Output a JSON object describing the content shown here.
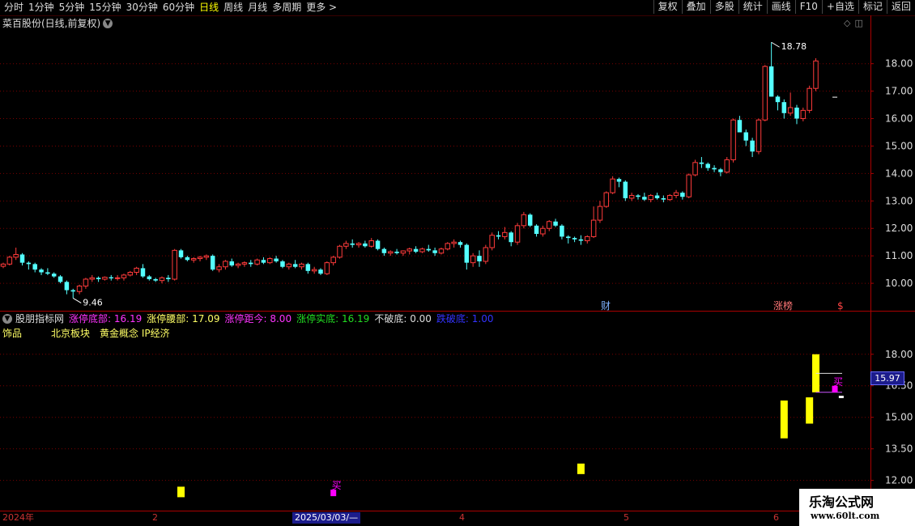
{
  "toolbar": {
    "periods": [
      "分时",
      "1分钟",
      "5分钟",
      "15分钟",
      "30分钟",
      "60分钟",
      "日线",
      "周线",
      "月线",
      "多周期",
      "更多 >"
    ],
    "active_period": "日线",
    "tools": [
      "复权",
      "叠加",
      "多股",
      "统计",
      "画线",
      "F10",
      "+自选",
      "标记",
      "返回"
    ]
  },
  "stock": {
    "title": "菜百股份(日线,前复权)"
  },
  "main_chart": {
    "max_label": "18.78",
    "min_label": "9.46",
    "markers": [
      {
        "text": "财",
        "color": "#7fb2ff"
      },
      {
        "text": "涨榜",
        "color": "#ff7777"
      },
      {
        "text": "$",
        "color": "#ff4444"
      }
    ]
  },
  "indicator": {
    "name": "股朋指标网",
    "fields": [
      {
        "label": "涨停底部:",
        "value": "16.19",
        "color": "#ff33ff"
      },
      {
        "label": "涨停腰部:",
        "value": "17.09",
        "color": "#ffff66"
      },
      {
        "label": "涨停距今:",
        "value": "8.00",
        "color": "#ff33ff"
      },
      {
        "label": "涨停实底:",
        "value": "16.19",
        "color": "#22dd22"
      },
      {
        "label": "不破底:",
        "value": "0.00",
        "color": "#dddddd"
      },
      {
        "label": "跌破底:",
        "value": "1.00",
        "color": "#3333ff"
      }
    ],
    "sector": "饰品　　　北京板块　黄金概念 IP经济",
    "buy_label": "买",
    "current_price": "15.97",
    "signal_colors": {
      "bar": "#ffff00",
      "buy": "#ff00ff",
      "line1": "#dddddd",
      "line2": "#cc55ff"
    }
  },
  "time_axis": {
    "labels": [
      "2024年",
      "2",
      "2025/03/03/—",
      "4",
      "5",
      "6"
    ],
    "selected": "2025/03/03/—"
  },
  "watermark": {
    "title": "乐淘公式网",
    "url": "www.60lt.com"
  },
  "chart_data": [
    {
      "type": "candlestick",
      "title": "菜百股份(日线,前复权)",
      "y_ticks": [
        10.0,
        11.0,
        12.0,
        13.0,
        14.0,
        15.0,
        16.0,
        17.0,
        18.0
      ],
      "ylim": [
        9.0,
        19.2
      ],
      "grid": true,
      "colors": {
        "up": "#ff3b3b",
        "down": "#54ffff",
        "grid": "#7a0000"
      },
      "ohlc": [
        [
          10.62,
          10.75,
          10.55,
          10.7
        ],
        [
          10.7,
          11.0,
          10.65,
          10.95
        ],
        [
          10.95,
          11.3,
          10.85,
          11.05
        ],
        [
          11.05,
          11.1,
          10.65,
          10.75
        ],
        [
          10.75,
          10.8,
          10.5,
          10.7
        ],
        [
          10.7,
          10.75,
          10.4,
          10.5
        ],
        [
          10.5,
          10.55,
          10.3,
          10.4
        ],
        [
          10.4,
          10.55,
          10.3,
          10.35
        ],
        [
          10.35,
          10.4,
          10.2,
          10.25
        ],
        [
          10.25,
          10.3,
          10.0,
          10.05
        ],
        [
          10.05,
          10.1,
          9.6,
          9.75
        ],
        [
          9.75,
          9.8,
          9.46,
          9.7
        ],
        [
          9.7,
          9.95,
          9.6,
          9.9
        ],
        [
          9.9,
          10.2,
          9.8,
          10.15
        ],
        [
          10.15,
          10.3,
          10.05,
          10.2
        ],
        [
          10.2,
          10.25,
          10.05,
          10.15
        ],
        [
          10.15,
          10.25,
          10.1,
          10.22
        ],
        [
          10.22,
          10.3,
          10.1,
          10.18
        ],
        [
          10.18,
          10.3,
          10.1,
          10.2
        ],
        [
          10.2,
          10.35,
          10.1,
          10.3
        ],
        [
          10.3,
          10.45,
          10.25,
          10.4
        ],
        [
          10.4,
          10.6,
          10.3,
          10.55
        ],
        [
          10.55,
          10.7,
          10.2,
          10.25
        ],
        [
          10.25,
          10.3,
          10.1,
          10.15
        ],
        [
          10.15,
          10.2,
          10.05,
          10.1
        ],
        [
          10.1,
          10.25,
          10.0,
          10.2
        ],
        [
          10.2,
          10.3,
          10.05,
          10.15
        ],
        [
          10.15,
          11.25,
          10.1,
          11.2
        ],
        [
          11.2,
          11.25,
          10.9,
          10.95
        ],
        [
          10.95,
          11.0,
          10.8,
          10.85
        ],
        [
          10.85,
          10.95,
          10.75,
          10.9
        ],
        [
          10.9,
          11.0,
          10.8,
          10.95
        ],
        [
          10.95,
          11.05,
          10.85,
          11.0
        ],
        [
          11.0,
          11.05,
          10.45,
          10.5
        ],
        [
          10.5,
          10.7,
          10.4,
          10.6
        ],
        [
          10.6,
          10.85,
          10.5,
          10.8
        ],
        [
          10.8,
          10.9,
          10.6,
          10.65
        ],
        [
          10.65,
          10.75,
          10.55,
          10.7
        ],
        [
          10.7,
          10.8,
          10.6,
          10.75
        ],
        [
          10.75,
          10.85,
          10.6,
          10.7
        ],
        [
          10.7,
          10.9,
          10.65,
          10.85
        ],
        [
          10.85,
          10.95,
          10.7,
          10.75
        ],
        [
          10.75,
          10.95,
          10.7,
          10.9
        ],
        [
          10.9,
          11.0,
          10.75,
          10.8
        ],
        [
          10.8,
          10.85,
          10.55,
          10.6
        ],
        [
          10.6,
          10.75,
          10.5,
          10.7
        ],
        [
          10.7,
          10.85,
          10.55,
          10.6
        ],
        [
          10.6,
          10.75,
          10.5,
          10.7
        ],
        [
          10.7,
          10.75,
          10.35,
          10.45
        ],
        [
          10.45,
          10.6,
          10.35,
          10.5
        ],
        [
          10.5,
          10.55,
          10.3,
          10.35
        ],
        [
          10.35,
          10.8,
          10.3,
          10.75
        ],
        [
          10.75,
          11.0,
          10.65,
          10.95
        ],
        [
          10.95,
          11.4,
          10.9,
          11.35
        ],
        [
          11.35,
          11.55,
          11.25,
          11.45
        ],
        [
          11.45,
          11.6,
          11.3,
          11.4
        ],
        [
          11.4,
          11.5,
          11.3,
          11.45
        ],
        [
          11.45,
          11.55,
          11.3,
          11.35
        ],
        [
          11.35,
          11.65,
          11.3,
          11.55
        ],
        [
          11.55,
          11.6,
          11.2,
          11.25
        ],
        [
          11.25,
          11.3,
          11.0,
          11.1
        ],
        [
          11.1,
          11.2,
          11.0,
          11.15
        ],
        [
          11.15,
          11.25,
          11.05,
          11.1
        ],
        [
          11.1,
          11.2,
          11.0,
          11.18
        ],
        [
          11.18,
          11.3,
          11.05,
          11.25
        ],
        [
          11.25,
          11.35,
          11.1,
          11.15
        ],
        [
          11.15,
          11.3,
          11.1,
          11.25
        ],
        [
          11.25,
          11.4,
          11.15,
          11.2
        ],
        [
          11.2,
          11.3,
          11.0,
          11.1
        ],
        [
          11.1,
          11.3,
          11.05,
          11.25
        ],
        [
          11.25,
          11.5,
          11.2,
          11.45
        ],
        [
          11.45,
          11.6,
          11.3,
          11.5
        ],
        [
          11.5,
          11.55,
          11.3,
          11.4
        ],
        [
          11.4,
          11.45,
          10.5,
          10.75
        ],
        [
          10.75,
          11.1,
          10.6,
          11.0
        ],
        [
          11.0,
          11.2,
          10.6,
          10.8
        ],
        [
          10.8,
          11.4,
          10.7,
          11.3
        ],
        [
          11.3,
          11.85,
          11.2,
          11.75
        ],
        [
          11.75,
          11.9,
          11.6,
          11.7
        ],
        [
          11.7,
          12.05,
          11.6,
          11.85
        ],
        [
          11.85,
          11.9,
          11.35,
          11.5
        ],
        [
          11.5,
          12.2,
          11.4,
          12.1
        ],
        [
          12.1,
          12.6,
          12.0,
          12.5
        ],
        [
          12.5,
          12.55,
          12.05,
          12.1
        ],
        [
          12.1,
          12.15,
          11.7,
          11.8
        ],
        [
          11.8,
          12.1,
          11.7,
          12.0
        ],
        [
          12.0,
          12.3,
          11.9,
          12.25
        ],
        [
          12.25,
          12.35,
          12.05,
          12.1
        ],
        [
          12.1,
          12.15,
          11.6,
          11.7
        ],
        [
          11.7,
          11.75,
          11.45,
          11.65
        ],
        [
          11.65,
          11.7,
          11.5,
          11.6
        ],
        [
          11.6,
          11.75,
          11.4,
          11.55
        ],
        [
          11.55,
          11.75,
          11.45,
          11.7
        ],
        [
          11.7,
          12.8,
          11.65,
          12.3
        ],
        [
          12.3,
          13.0,
          12.2,
          12.8
        ],
        [
          12.8,
          13.35,
          12.75,
          13.3
        ],
        [
          13.3,
          13.9,
          13.25,
          13.8
        ],
        [
          13.8,
          13.85,
          13.5,
          13.7
        ],
        [
          13.7,
          13.75,
          13.0,
          13.1
        ],
        [
          13.1,
          13.3,
          13.0,
          13.2
        ],
        [
          13.2,
          13.25,
          13.05,
          13.15
        ],
        [
          13.15,
          13.3,
          13.0,
          13.05
        ],
        [
          13.05,
          13.25,
          12.95,
          13.2
        ],
        [
          13.2,
          13.3,
          13.05,
          13.1
        ],
        [
          13.1,
          13.2,
          12.95,
          13.05
        ],
        [
          13.05,
          13.25,
          13.0,
          13.2
        ],
        [
          13.2,
          13.4,
          13.1,
          13.3
        ],
        [
          13.3,
          13.35,
          13.05,
          13.15
        ],
        [
          13.15,
          14.0,
          13.1,
          13.95
        ],
        [
          13.95,
          14.5,
          13.9,
          14.4
        ],
        [
          14.4,
          14.6,
          14.2,
          14.35
        ],
        [
          14.35,
          14.4,
          14.1,
          14.2
        ],
        [
          14.2,
          14.3,
          14.05,
          14.15
        ],
        [
          14.15,
          14.2,
          13.9,
          14.05
        ],
        [
          14.05,
          14.6,
          14.0,
          14.5
        ],
        [
          14.5,
          16.0,
          14.4,
          15.95
        ],
        [
          15.95,
          16.1,
          15.6,
          15.5
        ],
        [
          15.5,
          15.6,
          15.0,
          15.2
        ],
        [
          15.2,
          15.3,
          14.6,
          14.8
        ],
        [
          14.8,
          16.0,
          14.7,
          15.95
        ],
        [
          15.95,
          17.95,
          15.9,
          17.9
        ],
        [
          17.9,
          18.78,
          16.8,
          16.8
        ],
        [
          16.8,
          16.85,
          16.3,
          16.6
        ],
        [
          16.6,
          16.7,
          16.0,
          16.2
        ],
        [
          16.2,
          16.95,
          16.1,
          16.4
        ],
        [
          16.4,
          16.5,
          15.8,
          16.0
        ],
        [
          16.0,
          16.4,
          15.9,
          16.3
        ],
        [
          16.3,
          17.2,
          16.2,
          17.1
        ],
        [
          17.1,
          18.2,
          17.0,
          18.1
        ]
      ],
      "extra_dash": {
        "date_index": 131,
        "value": 16.78
      },
      "annotations": [
        {
          "text": "18.78",
          "value": 18.78
        },
        {
          "text": "9.46",
          "value": 9.46
        }
      ]
    },
    {
      "type": "bar",
      "title": "股朋指标网",
      "y_ticks": [
        12.0,
        13.5,
        15.0,
        16.5,
        18.0
      ],
      "ylim": [
        10.6,
        19.3
      ],
      "grid": true,
      "signal_bars": [
        {
          "index": 28,
          "low": 11.2,
          "high": 11.7
        },
        {
          "index": 91,
          "low": 12.3,
          "high": 12.8
        },
        {
          "index": 123,
          "low": 14.0,
          "high": 15.8
        },
        {
          "index": 127,
          "low": 14.7,
          "high": 15.95
        },
        {
          "index": 128,
          "low": 16.19,
          "high": 18.0
        }
      ],
      "buy_markers": [
        {
          "index": 52,
          "value": 11.25
        },
        {
          "index": 131,
          "value": 16.19
        }
      ],
      "levels": [
        {
          "name": "涨停腰部",
          "value": 17.09,
          "from_index": 128
        },
        {
          "name": "涨停底部",
          "value": 16.19,
          "from_index": 128
        }
      ],
      "current_price": 15.97
    }
  ]
}
